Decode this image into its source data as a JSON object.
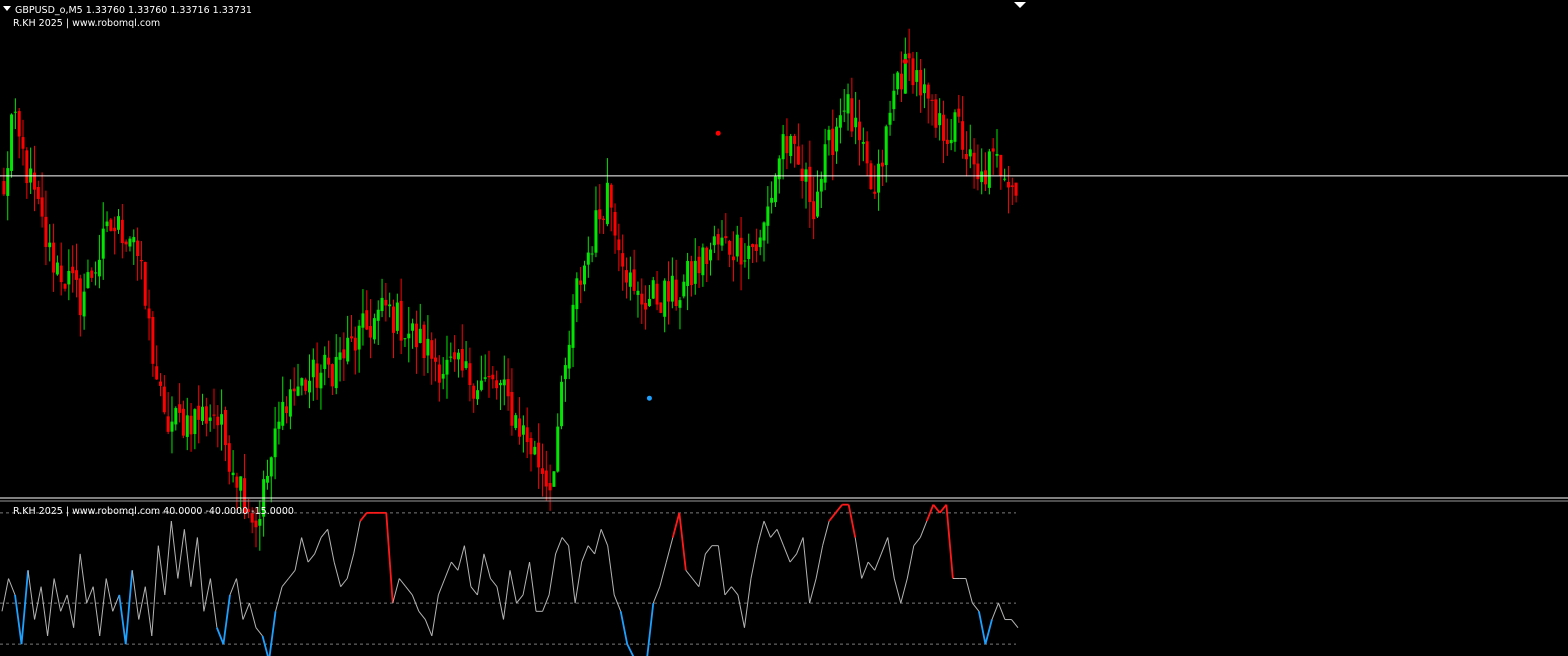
{
  "window": {
    "symbol_line": "GBPUSD_o,M5  1.33760 1.33760 1.33716 1.33731",
    "watermark": "R.KH 2025 | www.robomql.com",
    "indicator_line": "R.KH 2025 | www.robomql.com 40.0000 -40.0000 -15.0000"
  },
  "colors": {
    "background": "#000000",
    "bull": "#00e600",
    "bear": "#ff0000",
    "hline": "#ffffff",
    "osc": "#b4b4b4",
    "overbought": "#ff1a1a",
    "oversold": "#1ea0ff",
    "level_line": "#7a7a7a",
    "marker_red": "#ff0000",
    "marker_blue": "#1ea0ff"
  },
  "chart_data": [
    {
      "type": "candlestick",
      "symbol": "GBPUSD_o",
      "timeframe": "M5",
      "last_bar": {
        "open": 1.3376,
        "high": 1.3376,
        "low": 1.33716,
        "close": 1.33731
      },
      "horizontal_line": 1.33775,
      "price_range": [
        1.3308,
        1.341
      ],
      "shape": [
        [
          0,
          1.3372
        ],
        [
          2,
          1.339
        ],
        [
          5,
          1.3382
        ],
        [
          12,
          1.336
        ],
        [
          20,
          1.335
        ],
        [
          28,
          1.3366
        ],
        [
          34,
          1.3365
        ],
        [
          42,
          1.3322
        ],
        [
          55,
          1.3325
        ],
        [
          66,
          1.33
        ],
        [
          74,
          1.3329
        ],
        [
          86,
          1.3335
        ],
        [
          100,
          1.3348
        ],
        [
          115,
          1.3335
        ],
        [
          130,
          1.333
        ],
        [
          135,
          1.3322
        ],
        [
          143,
          1.3309
        ],
        [
          150,
          1.3352
        ],
        [
          158,
          1.3375
        ],
        [
          165,
          1.335
        ],
        [
          176,
          1.3351
        ],
        [
          186,
          1.3362
        ],
        [
          198,
          1.3362
        ],
        [
          204,
          1.3386
        ],
        [
          212,
          1.3372
        ],
        [
          220,
          1.3395
        ],
        [
          228,
          1.3372
        ],
        [
          234,
          1.34
        ],
        [
          238,
          1.3402
        ],
        [
          244,
          1.3388
        ],
        [
          250,
          1.3388
        ],
        [
          255,
          1.3375
        ],
        [
          258,
          1.338
        ],
        [
          262,
          1.338
        ],
        [
          265,
          1.3376
        ]
      ],
      "signals": [
        {
          "bar": 169,
          "price": 1.3328,
          "type": "buy",
          "color": "blue"
        },
        {
          "bar": 187,
          "price": 1.3387,
          "type": "sell",
          "color": "red"
        },
        {
          "bar": 236,
          "price": 1.3403,
          "type": "sell",
          "color": "red"
        }
      ]
    },
    {
      "type": "line",
      "name": "R.KH 2025 oscillator",
      "levels": [
        40,
        -40,
        -15
      ],
      "ylim": [
        -46,
        46
      ],
      "series": [
        {
          "name": "oscillator",
          "values": [
            -20,
            0,
            -10,
            -40,
            5,
            -25,
            -5,
            -35,
            0,
            -20,
            -10,
            -30,
            15,
            -15,
            -5,
            -35,
            0,
            -20,
            -10,
            -40,
            5,
            -25,
            -5,
            -35,
            20,
            -10,
            35,
            0,
            30,
            -5,
            25,
            -20,
            0,
            -30,
            -40,
            -10,
            0,
            -25,
            -15,
            -30,
            -35,
            -50,
            -20,
            -5,
            0,
            5,
            25,
            10,
            15,
            25,
            30,
            10,
            -5,
            0,
            15,
            35,
            40,
            40,
            40,
            40,
            -15,
            0,
            -5,
            -10,
            -20,
            -25,
            -35,
            -10,
            0,
            10,
            5,
            20,
            -5,
            -10,
            15,
            0,
            -5,
            -25,
            5,
            -15,
            -10,
            10,
            -20,
            -20,
            -10,
            15,
            25,
            20,
            -15,
            10,
            20,
            15,
            30,
            20,
            -10,
            -20,
            -40,
            -48,
            -50,
            -50,
            -15,
            -5,
            10,
            25,
            40,
            5,
            0,
            -5,
            15,
            20,
            20,
            -10,
            -5,
            -10,
            -30,
            0,
            20,
            35,
            25,
            30,
            20,
            10,
            15,
            25,
            -15,
            0,
            20,
            35,
            40,
            45,
            45,
            25,
            0,
            10,
            5,
            15,
            25,
            0,
            -15,
            0,
            20,
            25,
            35,
            45,
            40,
            45,
            0,
            0,
            0,
            -15,
            -20,
            -40,
            -25,
            -15,
            -25,
            -25,
            -30
          ]
        }
      ]
    }
  ]
}
